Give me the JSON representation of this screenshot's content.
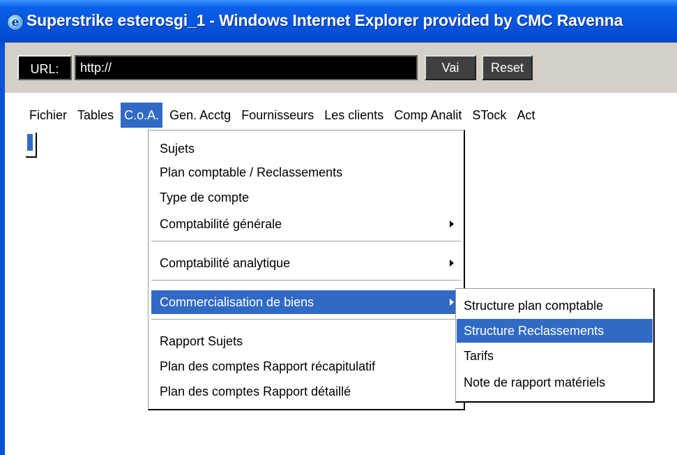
{
  "window": {
    "title": "Superstrike esterosgi_1 - Windows Internet Explorer provided by CMC Ravenna"
  },
  "toolbar": {
    "url_label": "URL:",
    "url_value": "http://",
    "go_label": "Vai",
    "reset_label": "Reset"
  },
  "menubar": {
    "items": [
      "Fichier",
      "Tables",
      "C.o.A.",
      "Gen. Acctg",
      "Fournisseurs",
      "Les clients",
      "Comp Analit",
      "STock",
      "Act"
    ]
  },
  "coa_menu": {
    "items": [
      "Sujets",
      "Plan comptable / Reclassements",
      "Type de compte",
      "Comptabilité générale",
      "Comptabilité analytique",
      "Commercialisation de biens",
      "Rapport Sujets",
      "Plan des comptes Rapport récapitulatif",
      "Plan des comptes Rapport détaillé"
    ]
  },
  "submenu": {
    "items": [
      "Structure plan comptable",
      "Structure Reclassements",
      "Tarifs",
      "Note de rapport matériels"
    ]
  },
  "colors": {
    "title_blue": "#0554dc",
    "highlight": "#316ac5",
    "toolbar_gray": "#d4d0c8"
  }
}
